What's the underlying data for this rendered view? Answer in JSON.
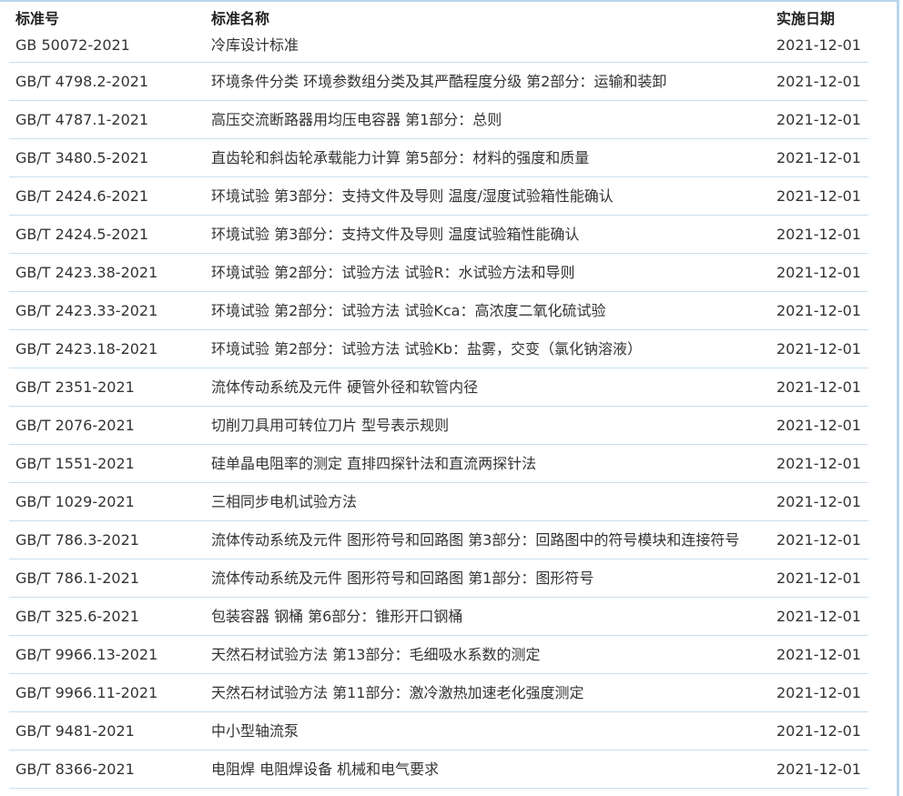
{
  "headers": {
    "code": "标准号",
    "name": "标准名称",
    "date": "实施日期"
  },
  "rows": [
    {
      "code": "GB 50072-2021",
      "name": "冷库设计标准",
      "date": "2021-12-01"
    },
    {
      "code": "GB/T 4798.2-2021",
      "name": "环境条件分类 环境参数组分类及其严酷程度分级 第2部分：运输和装卸",
      "date": "2021-12-01"
    },
    {
      "code": "GB/T 4787.1-2021",
      "name": "高压交流断路器用均压电容器 第1部分：总则",
      "date": "2021-12-01"
    },
    {
      "code": "GB/T 3480.5-2021",
      "name": "直齿轮和斜齿轮承载能力计算 第5部分：材料的强度和质量",
      "date": "2021-12-01"
    },
    {
      "code": "GB/T 2424.6-2021",
      "name": "环境试验 第3部分：支持文件及导则 温度/湿度试验箱性能确认",
      "date": "2021-12-01"
    },
    {
      "code": "GB/T 2424.5-2021",
      "name": "环境试验 第3部分：支持文件及导则 温度试验箱性能确认",
      "date": "2021-12-01"
    },
    {
      "code": "GB/T 2423.38-2021",
      "name": "环境试验 第2部分：试验方法 试验R：水试验方法和导则",
      "date": "2021-12-01"
    },
    {
      "code": "GB/T 2423.33-2021",
      "name": "环境试验 第2部分：试验方法 试验Kca：高浓度二氧化硫试验",
      "date": "2021-12-01"
    },
    {
      "code": "GB/T 2423.18-2021",
      "name": "环境试验 第2部分：试验方法 试验Kb：盐雾，交变（氯化钠溶液）",
      "date": "2021-12-01"
    },
    {
      "code": "GB/T 2351-2021",
      "name": "流体传动系统及元件 硬管外径和软管内径",
      "date": "2021-12-01"
    },
    {
      "code": "GB/T 2076-2021",
      "name": "切削刀具用可转位刀片 型号表示规则",
      "date": "2021-12-01"
    },
    {
      "code": "GB/T 1551-2021",
      "name": "硅单晶电阻率的测定 直排四探针法和直流两探针法",
      "date": "2021-12-01"
    },
    {
      "code": "GB/T 1029-2021",
      "name": "三相同步电机试验方法",
      "date": "2021-12-01"
    },
    {
      "code": "GB/T 786.3-2021",
      "name": "流体传动系统及元件 图形符号和回路图 第3部分：回路图中的符号模块和连接符号",
      "date": "2021-12-01"
    },
    {
      "code": "GB/T 786.1-2021",
      "name": "流体传动系统及元件 图形符号和回路图 第1部分：图形符号",
      "date": "2021-12-01"
    },
    {
      "code": "GB/T 325.6-2021",
      "name": "包装容器 钢桶 第6部分：锥形开口钢桶",
      "date": "2021-12-01"
    },
    {
      "code": "GB/T 9966.13-2021",
      "name": "天然石材试验方法 第13部分：毛细吸水系数的测定",
      "date": "2021-12-01"
    },
    {
      "code": "GB/T 9966.11-2021",
      "name": "天然石材试验方法 第11部分：激冷激热加速老化强度测定",
      "date": "2021-12-01"
    },
    {
      "code": "GB/T 9481-2021",
      "name": "中小型轴流泵",
      "date": "2021-12-01"
    },
    {
      "code": "GB/T 8366-2021",
      "name": "电阻焊 电阻焊设备 机械和电气要求",
      "date": "2021-12-01"
    }
  ]
}
